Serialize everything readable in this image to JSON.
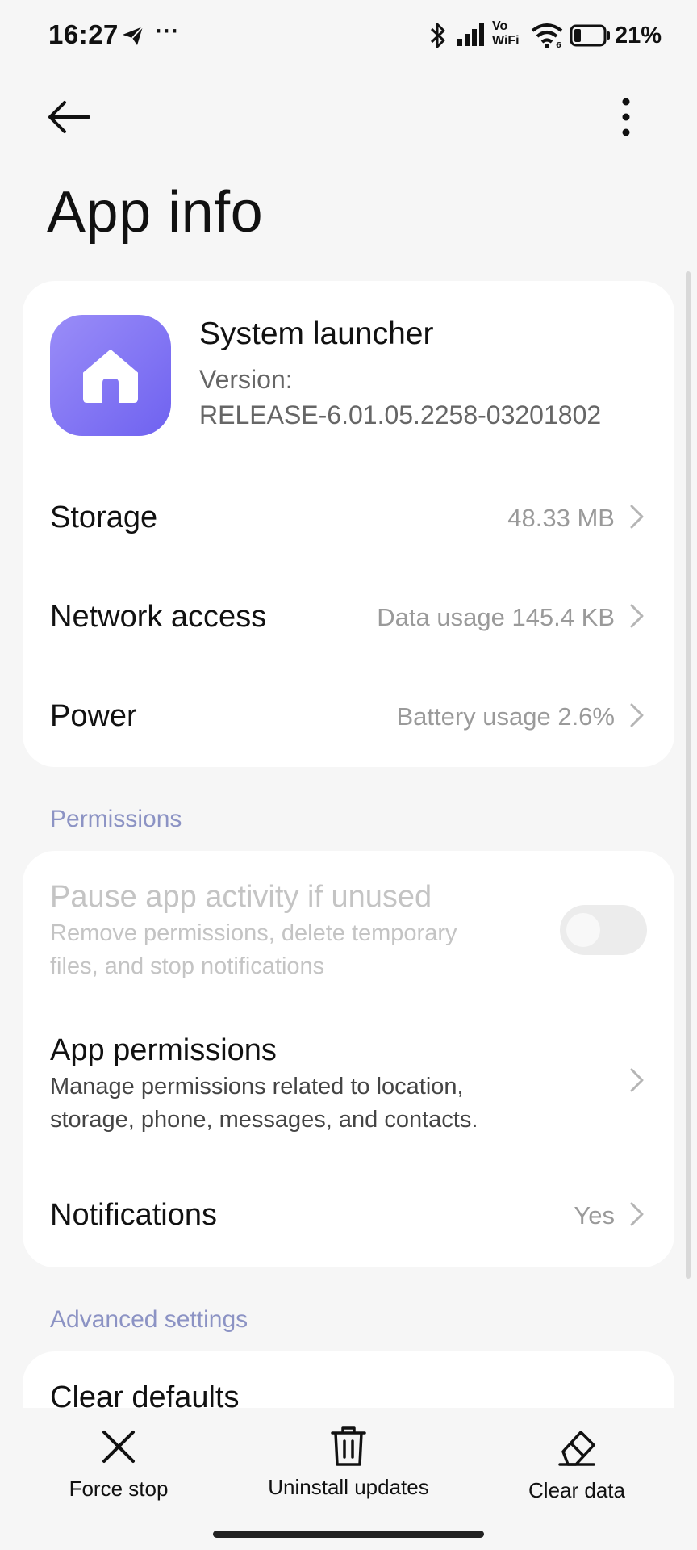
{
  "status_bar": {
    "time": "16:27",
    "more": "···",
    "vowifi_top": "Vo",
    "vowifi_bottom": "WiFi",
    "battery_percent": "21%"
  },
  "header": {
    "title": "App info"
  },
  "app": {
    "name": "System launcher",
    "version_label": "Version:",
    "version": "RELEASE-6.01.05.2258-03201802",
    "icon_color": "#7b6ef5"
  },
  "usage": [
    {
      "title": "Storage",
      "value": "48.33 MB"
    },
    {
      "title": "Network access",
      "value": "Data usage 145.4 KB"
    },
    {
      "title": "Power",
      "value": "Battery usage 2.6%"
    }
  ],
  "permissions": {
    "section_label": "Permissions",
    "pause": {
      "title": "Pause app activity if unused",
      "line1": "Remove permissions, delete temporary",
      "line2": "files, and stop notifications",
      "enabled": false
    },
    "app_permissions": {
      "title": "App permissions",
      "line1": "Manage permissions related to location,",
      "line2": "storage, phone, messages, and contacts."
    },
    "notifications": {
      "title": "Notifications",
      "value": "Yes"
    }
  },
  "advanced": {
    "section_label": "Advanced settings",
    "clear_defaults": "Clear defaults"
  },
  "actions": {
    "force_stop": "Force stop",
    "uninstall_updates": "Uninstall updates",
    "clear_data": "Clear data"
  },
  "colors": {
    "accent_section": "#8c93c4",
    "background": "#f6f6f6"
  }
}
